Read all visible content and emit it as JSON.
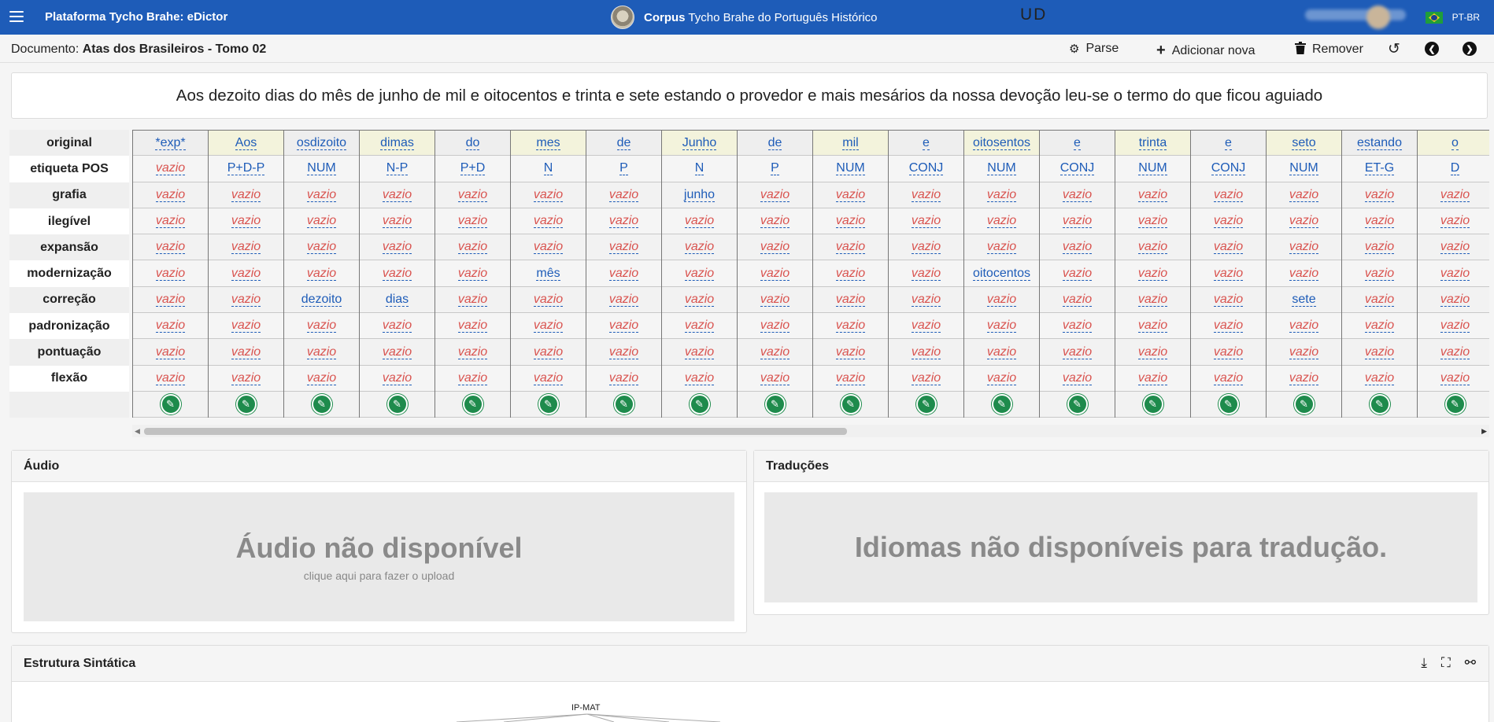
{
  "navbar": {
    "app_title": "Plataforma Tycho Brahe: eDictor",
    "corpus_bold": "Corpus",
    "corpus_rest": " Tycho Brahe do Português Histórico",
    "language": "PT-BR",
    "icons": [
      "hamburger-icon",
      "brazil-flag-icon"
    ]
  },
  "docbar": {
    "doc_prefix": "Documento: ",
    "doc_name": "Atas dos Brasileiros - Tomo 02",
    "ud_label": "UD",
    "parse_label": "Parse",
    "add_label": "Adicionar nova",
    "remove_label": "Remover",
    "icons": [
      "gears-icon",
      "plus-icon",
      "trash-icon",
      "undo-icon",
      "chevron-left-icon",
      "chevron-right-icon"
    ]
  },
  "sentence": "Aos dezoito dias do mês de junho de mil e oitocentos e trinta e sete estando o provedor e mais mesários da nossa devoção leu-se o termo do que ficou aguiado",
  "row_labels": [
    "original",
    "etiqueta POS",
    "grafia",
    "ilegível",
    "expansão",
    "modernização",
    "correção",
    "padronização",
    "pontuação",
    "flexão"
  ],
  "empty_text": "vazio",
  "tokens": [
    {
      "original": "*exp*",
      "pos": "vazio",
      "grafia": "",
      "modernizacao": "",
      "correcao": ""
    },
    {
      "original": "Aos",
      "pos": "P+D-P",
      "grafia": "",
      "modernizacao": "",
      "correcao": ""
    },
    {
      "original": "osdizoito",
      "pos": "NUM",
      "grafia": "",
      "modernizacao": "",
      "correcao": "dezoito"
    },
    {
      "original": "dimas",
      "pos": "N-P",
      "grafia": "",
      "modernizacao": "",
      "correcao": "dias"
    },
    {
      "original": "do",
      "pos": "P+D",
      "grafia": "",
      "modernizacao": "",
      "correcao": ""
    },
    {
      "original": "mes",
      "pos": "N",
      "grafia": "",
      "modernizacao": "mês",
      "correcao": ""
    },
    {
      "original": "de",
      "pos": "P",
      "grafia": "",
      "modernizacao": "",
      "correcao": ""
    },
    {
      "original": "Junho",
      "pos": "N",
      "grafia": "junho",
      "modernizacao": "",
      "correcao": ""
    },
    {
      "original": "de",
      "pos": "P",
      "grafia": "",
      "modernizacao": "",
      "correcao": ""
    },
    {
      "original": "mil",
      "pos": "NUM",
      "grafia": "",
      "modernizacao": "",
      "correcao": ""
    },
    {
      "original": "e",
      "pos": "CONJ",
      "grafia": "",
      "modernizacao": "",
      "correcao": ""
    },
    {
      "original": "oitosentos",
      "pos": "NUM",
      "grafia": "",
      "modernizacao": "oitocentos",
      "correcao": ""
    },
    {
      "original": "e",
      "pos": "CONJ",
      "grafia": "",
      "modernizacao": "",
      "correcao": ""
    },
    {
      "original": "trinta",
      "pos": "NUM",
      "grafia": "",
      "modernizacao": "",
      "correcao": ""
    },
    {
      "original": "e",
      "pos": "CONJ",
      "grafia": "",
      "modernizacao": "",
      "correcao": ""
    },
    {
      "original": "seto",
      "pos": "NUM",
      "grafia": "",
      "modernizacao": "",
      "correcao": "sete"
    },
    {
      "original": "estando",
      "pos": "ET-G",
      "grafia": "",
      "modernizacao": "",
      "correcao": ""
    },
    {
      "original": "o",
      "pos": "D",
      "grafia": "",
      "modernizacao": "",
      "correcao": ""
    }
  ],
  "audio": {
    "title": "Áudio",
    "empty_title": "Áudio não disponível",
    "empty_sub": "clique aqui para fazer o upload"
  },
  "translations": {
    "title": "Traduções",
    "empty_title": "Idiomas não disponíveis para tradução."
  },
  "syntax": {
    "title": "Estrutura Sintática",
    "root_node": "IP-MAT",
    "icons": [
      "download-icon",
      "fullscreen-icon",
      "share-icon"
    ]
  }
}
